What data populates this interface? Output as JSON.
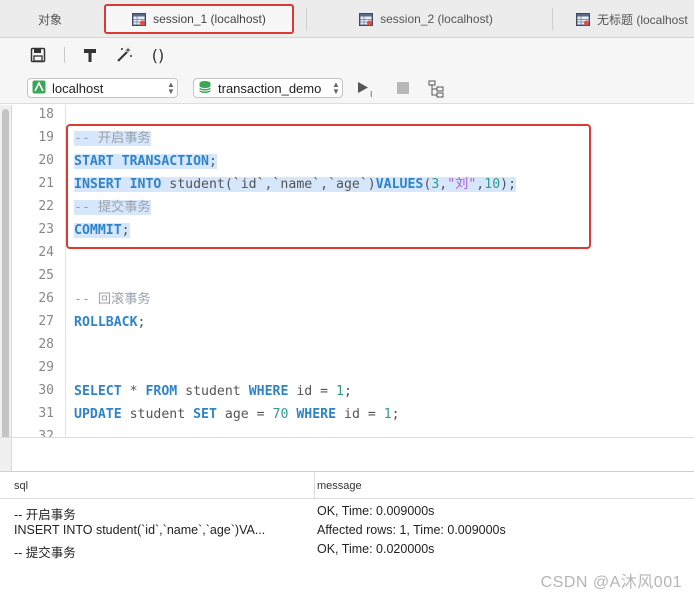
{
  "tabs": {
    "objects": "对象",
    "session1": "session_1 (localhost)",
    "session2": "session_2 (localhost)",
    "untitled": "无标题 (localhost"
  },
  "toolbar": {
    "save_icon": "save-icon",
    "format_icon": "format-icon",
    "beautify_icon": "magic-wand-icon",
    "paren_icon": "parentheses-icon",
    "paren_glyph": "()"
  },
  "connection": {
    "host": "localhost",
    "database": "transaction_demo"
  },
  "editor": {
    "line_numbers": [
      "18",
      "19",
      "20",
      "21",
      "22",
      "23",
      "24",
      "25",
      "26",
      "27",
      "28",
      "29",
      "30",
      "31",
      "32"
    ]
  },
  "code": {
    "l19_comment": "-- 开启事务",
    "l20_kw": "START TRANSACTION",
    "l20_punct": ";",
    "l21_kw1": "INSERT INTO",
    "l21_a": " student(`id`,`name`,`age`)",
    "l21_kw2": "VALUES",
    "l21_b": "(",
    "l21_n1": "3",
    "l21_c": ",",
    "l21_str": "\"刘\"",
    "l21_d": ",",
    "l21_n2": "10",
    "l21_e": ");",
    "l22_comment": "-- 提交事务",
    "l23_kw": "COMMIT",
    "l23_punct": ";",
    "l26_comment": "-- 回滚事务",
    "l27_kw": "ROLLBACK",
    "l27_punct": ";",
    "l30_kw1": "SELECT",
    "l30_a": " * ",
    "l30_kw2": "FROM",
    "l30_b": " student ",
    "l30_kw3": "WHERE",
    "l30_c": " id = ",
    "l30_n": "1",
    "l30_d": ";",
    "l31_kw1": "UPDATE",
    "l31_a": " student ",
    "l31_kw2": "SET",
    "l31_b": " age = ",
    "l31_n1": "70",
    "l31_c": " ",
    "l31_kw3": "WHERE",
    "l31_d": " id = ",
    "l31_n2": "1",
    "l31_e": ";"
  },
  "result": {
    "columns": [
      "sql",
      "message"
    ],
    "rows": [
      {
        "sql": "-- 开启事务",
        "message": "OK, Time: 0.009000s"
      },
      {
        "sql": "INSERT INTO student(`id`,`name`,`age`)VA...",
        "message": "Affected rows: 1, Time: 0.009000s"
      },
      {
        "sql": "-- 提交事务",
        "message": "OK, Time: 0.020000s"
      }
    ]
  },
  "watermark": "CSDN @A沐风001",
  "colors": {
    "keyword": "#2f84c9",
    "comment": "#9aa3ad",
    "string": "#b15bd3",
    "number": "#2f9a91",
    "selection": "#d7e7fb",
    "highlight_border": "#d93a33"
  }
}
